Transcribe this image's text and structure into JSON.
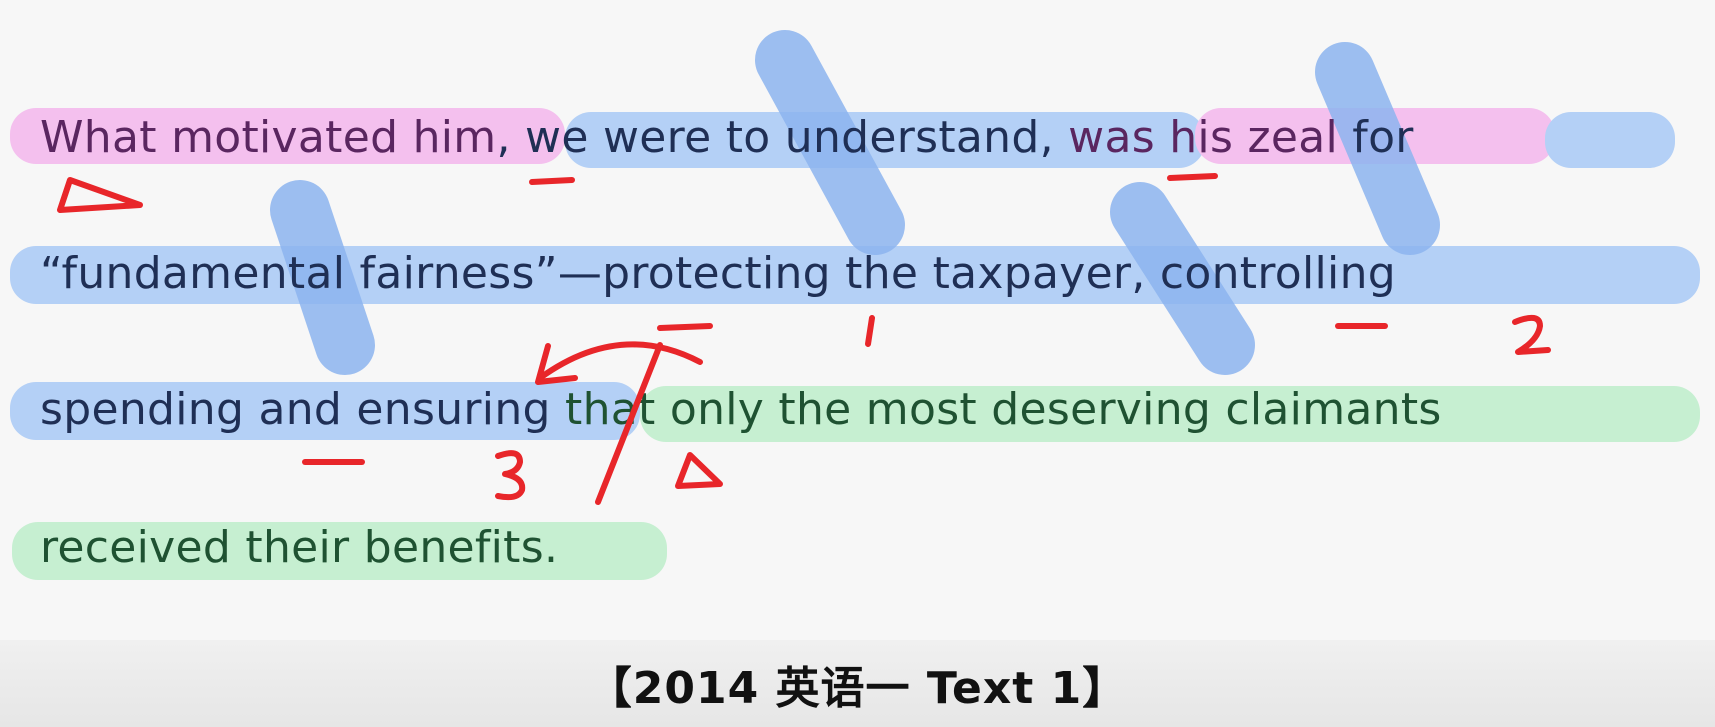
{
  "sentence": {
    "line1": {
      "part_pink1": "What motivated him",
      "part_blue1": ", we were to understand,",
      "part_pink2": " was his zeal",
      "part_blue2": " for"
    },
    "line2": {
      "part_blue": "“fundamental fairness”—protecting the taxpayer, controlling"
    },
    "line3": {
      "part_blue": "spending and ensuring",
      "part_green": " that only the most deserving claimants"
    },
    "line4": {
      "part_green": "received their benefits."
    }
  },
  "annotations": {
    "mark1": "1",
    "mark2": "2",
    "mark3": "3"
  },
  "footer": {
    "caption": "【2014 英语一 Text 1】"
  },
  "colors": {
    "pink_highlight": "#f4c0ee",
    "blue_highlight": "#b4d0f6",
    "green_highlight": "#c6efd1",
    "red_ink": "#e8262a"
  }
}
